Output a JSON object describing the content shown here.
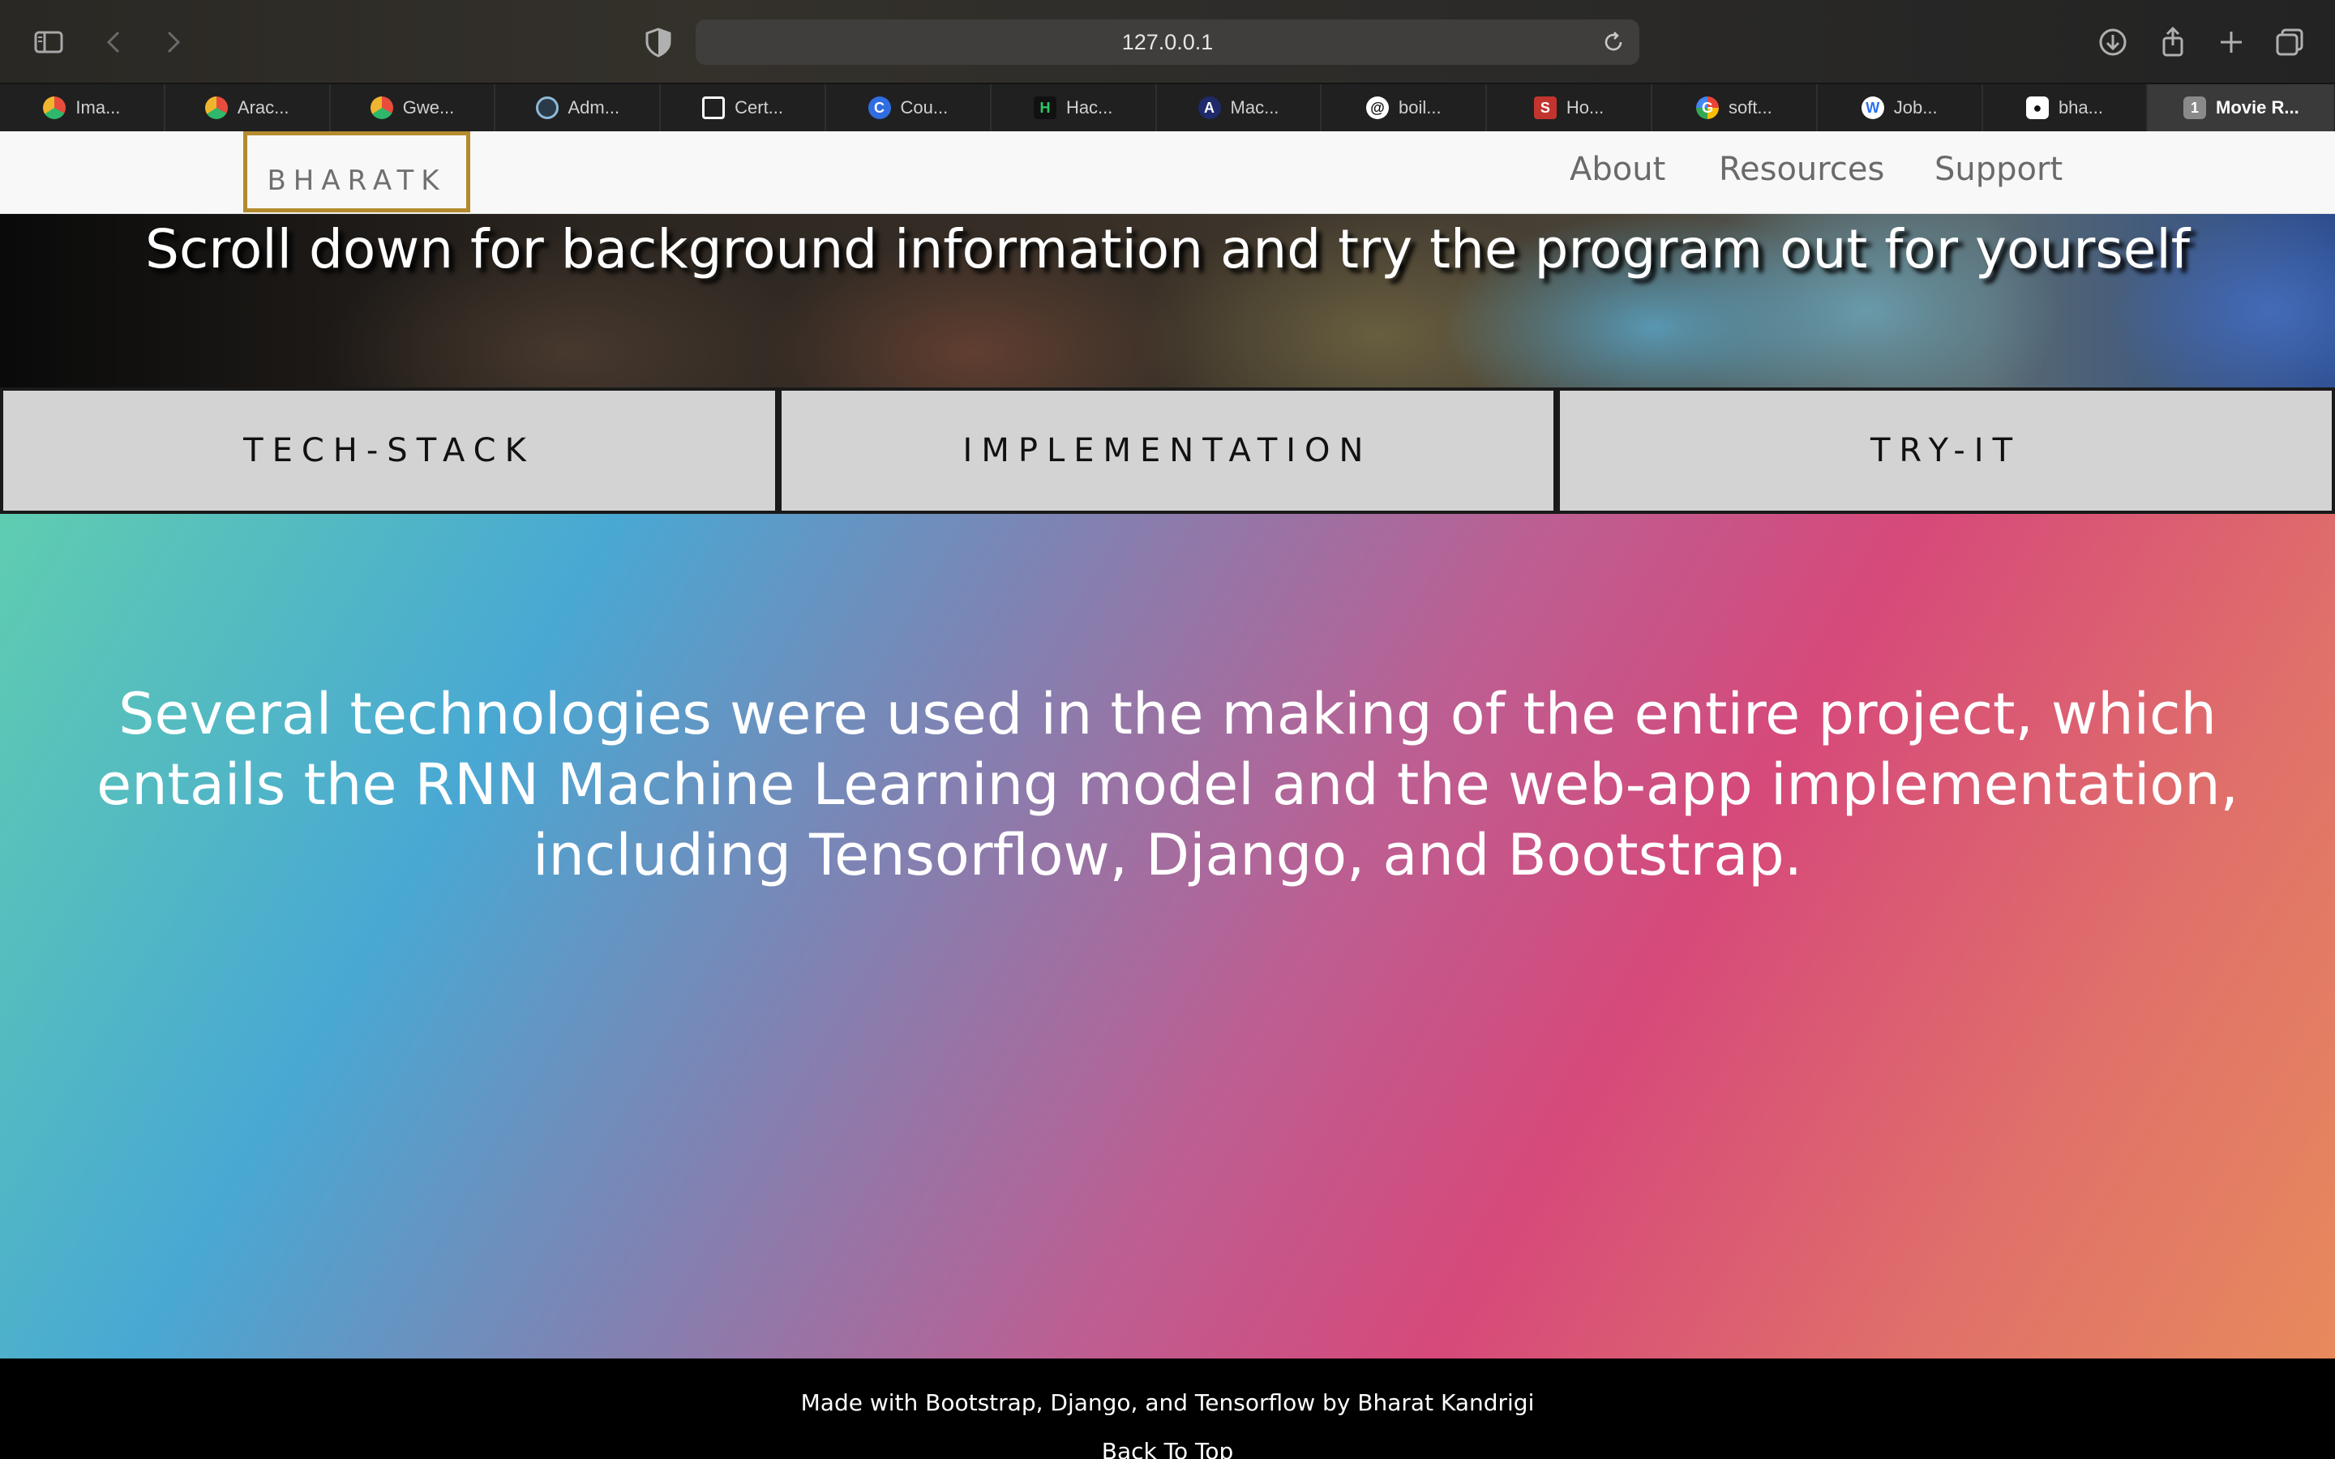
{
  "browser": {
    "url": "127.0.0.1",
    "tabs": [
      {
        "label": "Ima...",
        "icon": "colorful-dots-icon",
        "color": "#e84c3d"
      },
      {
        "label": "Arac...",
        "icon": "colorful-dots-icon",
        "color": "#e84c3d"
      },
      {
        "label": "Gwe...",
        "icon": "colorful-dots-icon",
        "color": "#e84c3d"
      },
      {
        "label": "Adm...",
        "icon": "eye-icon",
        "color": "#8fb9d8"
      },
      {
        "label": "Cert...",
        "icon": "triangle-logo-icon",
        "color": "#ffffff"
      },
      {
        "label": "Cou...",
        "icon": "c-logo-icon",
        "color": "#2f6de1"
      },
      {
        "label": "Hac...",
        "icon": "h-logo-icon",
        "color": "#1c1c1c"
      },
      {
        "label": "Mac...",
        "icon": "a-logo-icon",
        "color": "#1f2a6b"
      },
      {
        "label": "boil...",
        "icon": "spiral-icon",
        "color": "#ffffff"
      },
      {
        "label": "Ho...",
        "icon": "s-logo-icon",
        "color": "#c2352f"
      },
      {
        "label": "soft...",
        "icon": "google-icon",
        "color": "#ffffff"
      },
      {
        "label": "Job...",
        "icon": "w-logo-icon",
        "color": "#2a6ff0"
      },
      {
        "label": "bha...",
        "icon": "github-icon",
        "color": "#ffffff"
      }
    ],
    "active_tab": {
      "count": "1",
      "label": "Movie R..."
    }
  },
  "navbar": {
    "brand": "BHARATK",
    "links": [
      "About",
      "Resources",
      "Support"
    ]
  },
  "hero": {
    "title": "Scroll down for background information and try the program out for yourself"
  },
  "sections": [
    "TECH-STACK",
    "IMPLEMENTATION",
    "TRY-IT"
  ],
  "content": {
    "text": "Several technologies were used in the making of the entire project, which entails the RNN Machine Learning model and the web-app implementation, including Tensorflow, Django, and Bootstrap."
  },
  "footer": {
    "made_with": "Made with Bootstrap, Django, and Tensorflow by Bharat Kandrigi",
    "back_to_top": "Back To Top"
  },
  "colors": {
    "brand_border": "#b38b2e",
    "section_bg": "#d3d3d3"
  }
}
